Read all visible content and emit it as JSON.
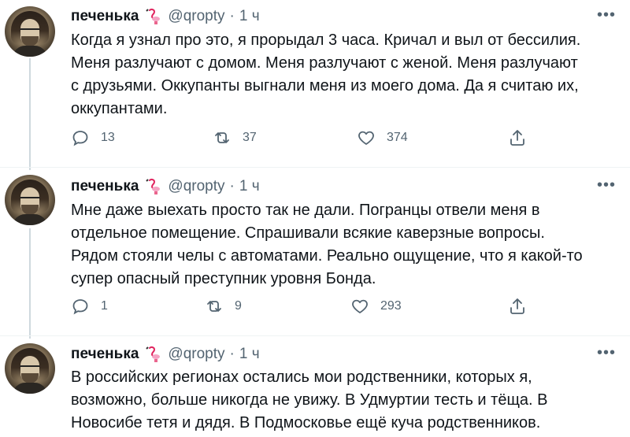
{
  "tweets": [
    {
      "author": {
        "name": "печенька",
        "handle": "@qropty"
      },
      "time": "1 ч",
      "text": "Когда я узнал про это, я прорыдал 3 часа. Кричал и выл от бессилия.\nМеня разлучают с домом. Меня разлучают с женой. Меня разлучают\nс друзьями. Оккупанты выгнали меня из моего дома. Да я считаю их,\nоккупантами.",
      "replies": "13",
      "retweets": "37",
      "likes": "374"
    },
    {
      "author": {
        "name": "печенька",
        "handle": "@qropty"
      },
      "time": "1 ч",
      "text": "Мне даже выехать просто так не дали. Погранцы отвели меня в\nотдельное помещение. Спрашивали всякие каверзные вопросы.\nРядом стояли челы с автоматами. Реально ощущение, что я какой-то\nсупер опасный преступник уровня Бонда.",
      "replies": "1",
      "retweets": "9",
      "likes": "293"
    },
    {
      "author": {
        "name": "печенька",
        "handle": "@qropty"
      },
      "time": "1 ч",
      "text": "В российских регионах остались мои родственники, которых я,\nвозможно, больше никогда не увижу. В Удмуртии тесть и тёща. В\nНовосибе тетя и дядя. В Подмосковье ещё куча родственников."
    }
  ],
  "icons": {
    "reply": "reply-icon",
    "retweet": "retweet-icon",
    "like": "heart-icon",
    "share": "share-icon",
    "more": "more-icon",
    "badge": "flamingo-icon"
  },
  "colors": {
    "text": "#0f1419",
    "secondary": "#536471",
    "thread_line": "#cfd9de"
  }
}
